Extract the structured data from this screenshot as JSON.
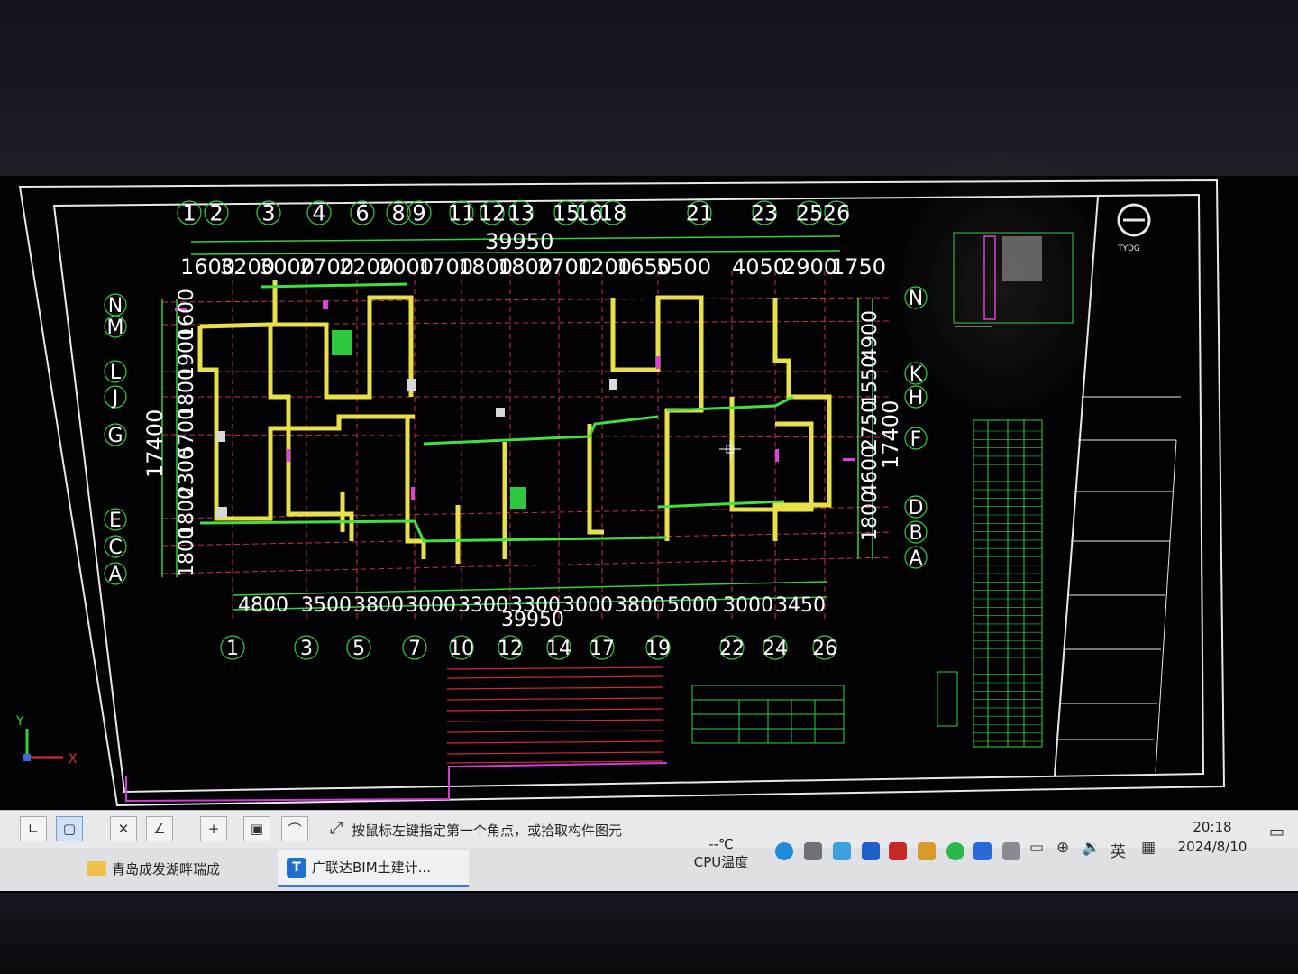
{
  "grid_top": {
    "axes": [
      "1",
      "2",
      "3",
      "4",
      "6",
      "8",
      "9",
      "11",
      "12",
      "13",
      "15",
      "16",
      "18",
      "21",
      "23",
      "25",
      "26"
    ],
    "total": "39950",
    "dims": [
      "1600",
      "3200",
      "3000",
      "2700",
      "2200",
      "2000",
      "1700",
      "1800",
      "1800",
      "2700",
      "1200",
      "1650",
      "5500",
      "4050",
      "2900",
      "1750"
    ]
  },
  "grid_bottom": {
    "axes": [
      "1",
      "3",
      "5",
      "7",
      "10",
      "12",
      "14",
      "17",
      "19",
      "22",
      "24",
      "26"
    ],
    "total": "39950",
    "dims": [
      "4800",
      "3500",
      "3800",
      "3000",
      "3300",
      "3300",
      "3000",
      "3800",
      "5000",
      "3000",
      "3450"
    ]
  },
  "grid_left": {
    "axes": [
      "N",
      "M",
      "L",
      "J",
      "G",
      "E",
      "C",
      "A"
    ],
    "total": "17400",
    "dims": [
      "1800",
      "1800",
      "2300",
      "5700",
      "1800",
      "1900",
      "1600"
    ]
  },
  "grid_right": {
    "axes": [
      "N",
      "K",
      "H",
      "F",
      "D",
      "B",
      "A"
    ],
    "total": "17400",
    "dims": [
      "4900",
      "1550",
      "2750",
      "4600",
      "1800"
    ]
  },
  "title_block": {
    "logo_text": "TYDG"
  },
  "axis_indicator": {
    "y": "Y",
    "x": "X"
  },
  "command": {
    "prompt": "按鼠标左键指定第一个角点，或拾取构件图元"
  },
  "taskbar": {
    "tasks": [
      {
        "label": "青岛成发湖畔瑞成"
      },
      {
        "label": "广联达BIM土建计..."
      }
    ],
    "cpu_value": "--℃",
    "cpu_label": "CPU温度",
    "ime": "英",
    "time": "20:18",
    "date": "2024/8/10"
  },
  "colors": {
    "wall": "#e8e04a",
    "grid": "#2fd23f",
    "axis_line": "#c8344a",
    "frame": "#ffffff",
    "accent_magenta": "#e040e0"
  }
}
